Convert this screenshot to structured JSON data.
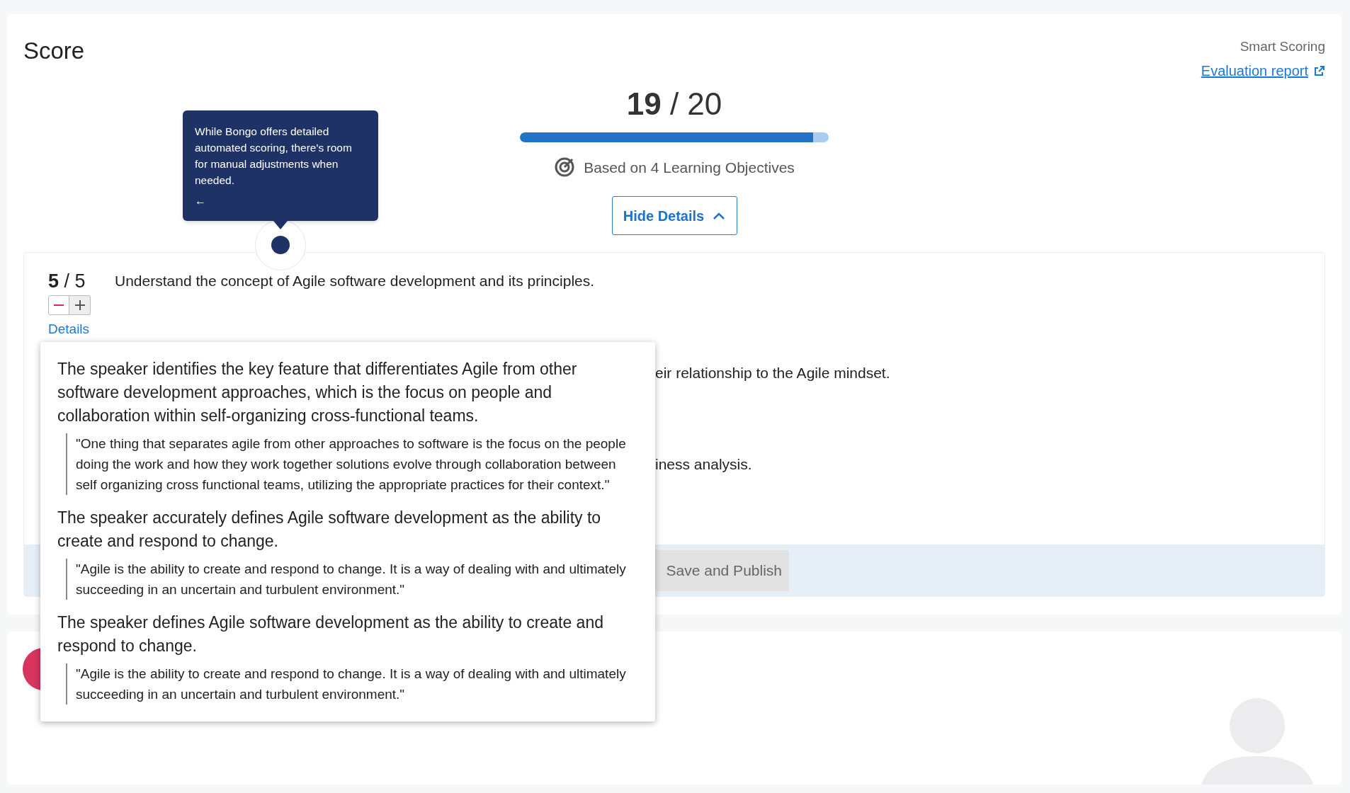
{
  "header": {
    "title": "Score",
    "smart_scoring": "Smart Scoring",
    "report_link": "Evaluation report"
  },
  "score": {
    "earned": "19",
    "total": "/ 20",
    "level": 0.95,
    "basis": "Based on 4 Learning Objectives"
  },
  "toggle_button": "Hide Details",
  "tooltip": {
    "text": "While Bongo offers detailed automated scoring, there's room for manual adjustments when needed.",
    "back": "←"
  },
  "objectives": [
    {
      "kind": "full",
      "earned": "5",
      "total": "/ 5",
      "text": "Understand the concept of Agile software development and its principles.",
      "details": "Details"
    },
    {
      "kind": "partial",
      "text": "eir relationship to the Agile mindset."
    },
    {
      "kind": "partial",
      "text": "iness analysis."
    }
  ],
  "popover": [
    {
      "statement": "The speaker identifies the key feature that differentiates Agile from other software development approaches, which is the focus on people and collaboration within self-organizing cross-functional teams.",
      "quote": "\"One thing that separates agile from other approaches to software is the focus on the people doing the work and how they work together solutions evolve through collaboration between self organizing cross functional teams, utilizing the appropriate practices for their context.\""
    },
    {
      "statement": "The speaker accurately defines Agile software development as the ability to create and respond to change.",
      "quote": "\"Agile is the ability to create and respond to change. It is a way of dealing with and ultimately succeeding in an uncertain and turbulent environment.\""
    },
    {
      "statement": "The speaker defines Agile software development as the ability to create and respond to change.",
      "quote": "\"Agile is the ability to create and respond to change. It is a way of dealing with and ultimately succeeding in an uncertain and turbulent environment.\""
    }
  ],
  "footer": {
    "save_button": "Save and Publish"
  }
}
